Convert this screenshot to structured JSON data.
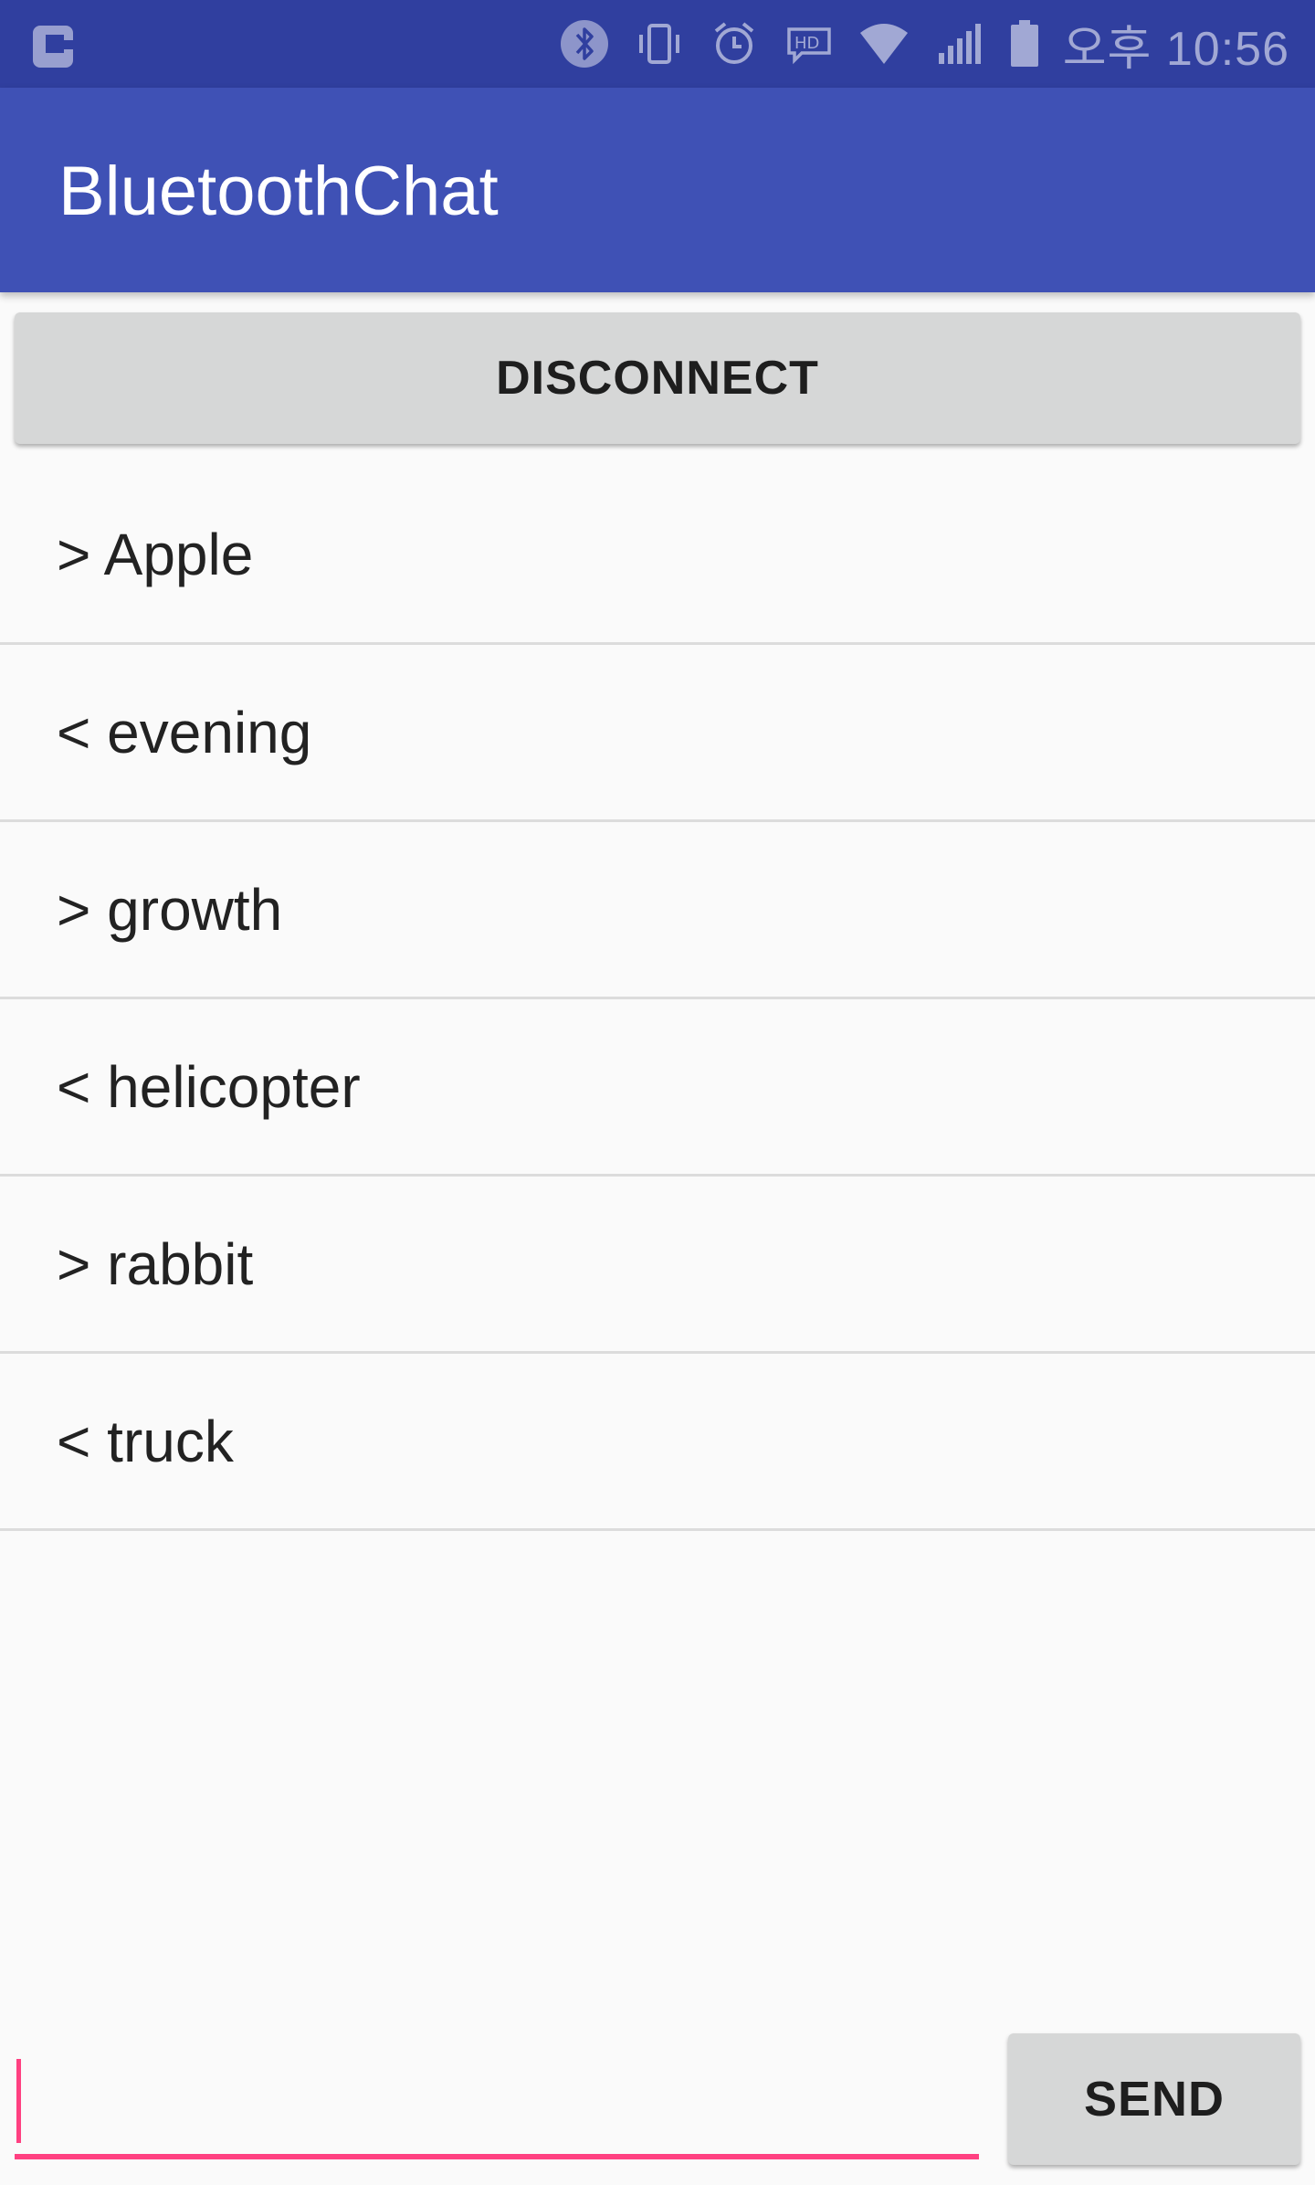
{
  "status_bar": {
    "carrier_icon": "carrier-logo-icon",
    "icons": [
      "bluetooth-icon",
      "vibrate-icon",
      "alarm-icon",
      "hd-voice-icon",
      "wifi-icon",
      "signal-icon",
      "battery-icon"
    ],
    "ampm": "오후",
    "time": "10:56"
  },
  "app_bar": {
    "title": "BluetoothChat"
  },
  "controls": {
    "disconnect_label": "DISCONNECT",
    "send_label": "SEND"
  },
  "messages": [
    {
      "text": "> Apple"
    },
    {
      "text": "< evening"
    },
    {
      "text": "> growth"
    },
    {
      "text": "< helicopter"
    },
    {
      "text": "> rabbit"
    },
    {
      "text": "< truck"
    }
  ],
  "input": {
    "value": "",
    "placeholder": ""
  },
  "colors": {
    "status_bar": "#303f9f",
    "app_bar": "#3f51b5",
    "accent": "#ff4081",
    "background": "#fafafa",
    "button": "#d6d7d7",
    "divider": "#dcdcdc"
  }
}
